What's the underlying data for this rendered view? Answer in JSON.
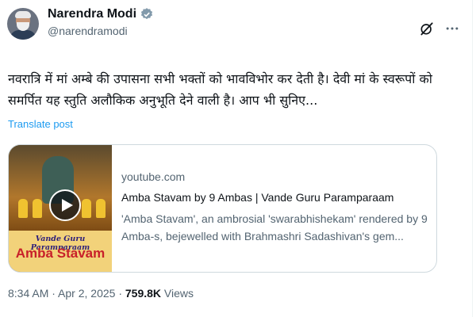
{
  "author": {
    "display_name": "Narendra Modi",
    "handle": "@narendramodi",
    "verified": true
  },
  "tweet": {
    "text": "नवरात्रि में मां अम्बे की उपासना सभी भक्तों को भावविभोर कर देती है। देवी मां के स्वरूपों को समर्पित यह स्तुति अलौकिक अनुभूति देने वाली है। आप भी सुनिए...",
    "translate_label": "Translate post"
  },
  "link_card": {
    "domain": "youtube.com",
    "title": "Amba Stavam by 9 Ambas | Vande Guru Paramparaam",
    "description": "'Amba Stavam', an ambrosial 'swarabhishekam' rendered by 9 Amba-s, bejewelled with Brahmashri Sadashivan's gem...",
    "thumbnail": {
      "banner_line1": "Vande Guru Paramparaam",
      "banner_line2": "Amba Stavam"
    }
  },
  "meta": {
    "time": "8:34 AM",
    "separator1": " · ",
    "date": "Apr 2, 2025",
    "separator2": " · ",
    "views_count": "759.8K",
    "views_label": " Views"
  },
  "colors": {
    "accent": "#1d9bf0",
    "text": "#0f1419",
    "secondary_text": "#536471",
    "border": "#cfd9de"
  }
}
